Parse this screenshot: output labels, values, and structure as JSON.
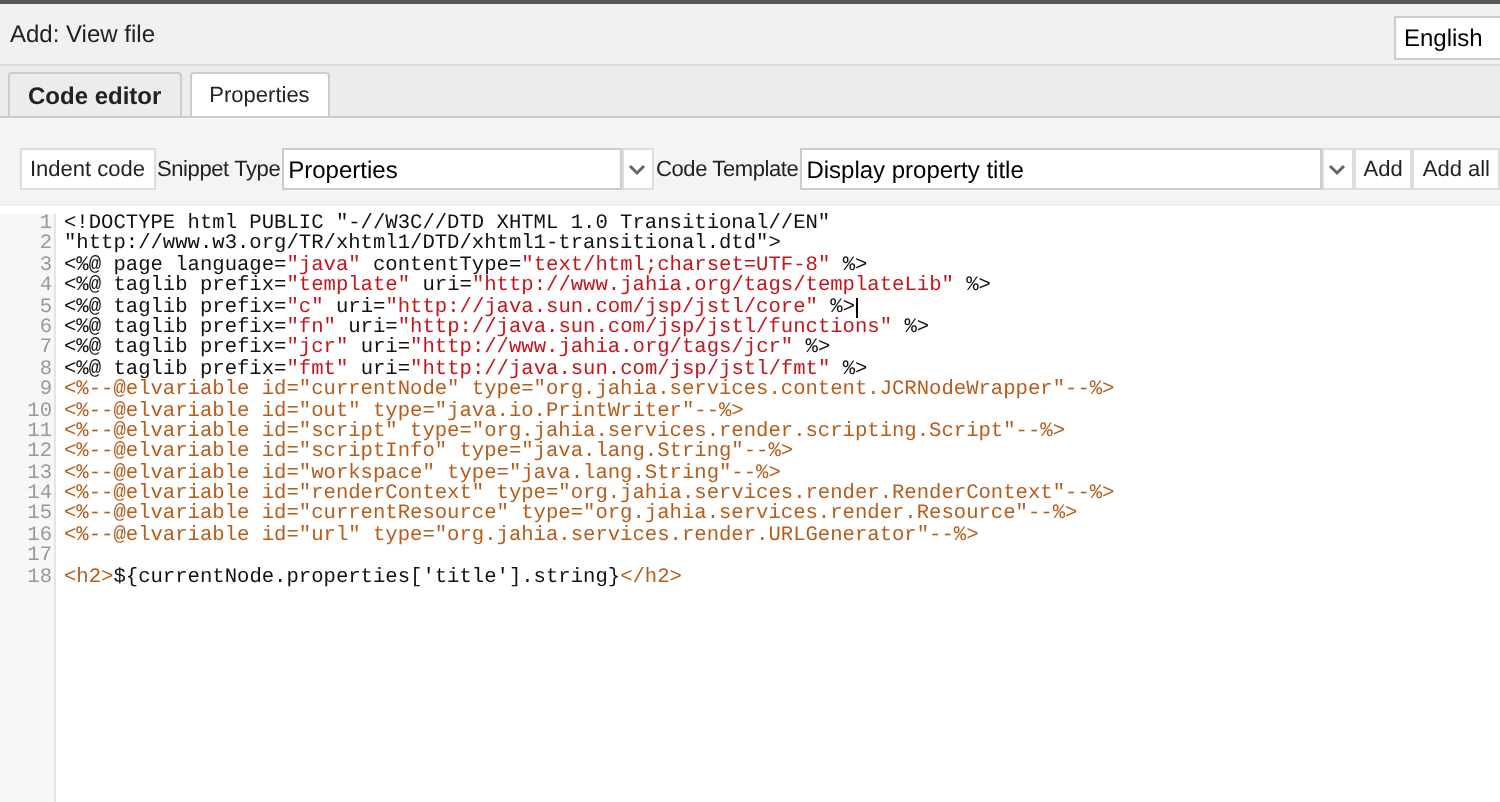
{
  "header": {
    "title": "Add: View file",
    "language": "English"
  },
  "tabs": [
    {
      "label": "Code editor",
      "selected": true
    },
    {
      "label": "Properties",
      "selected": false
    }
  ],
  "toolbar": {
    "indent_button": "Indent code",
    "snippet_label": "Snippet Type",
    "snippet_value": "Properties",
    "template_label": "Code Template",
    "template_value": "Display property title",
    "add_button": "Add",
    "add_all_button": "Add all"
  },
  "code_lines": [
    {
      "number": "1",
      "tokens": [
        {
          "kind": "plain",
          "text": "<!DOCTYPE html PUBLIC \"-//W3C//DTD XHTML 1.0 Transitional//EN\""
        }
      ]
    },
    {
      "number": "2",
      "tokens": [
        {
          "kind": "plain",
          "text": "\"http://www.w3.org/TR/xhtml1/DTD/xhtml1-transitional.dtd\">"
        }
      ]
    },
    {
      "number": "3",
      "tokens": [
        {
          "kind": "plain",
          "text": "<%@ page language="
        },
        {
          "kind": "string",
          "text": "\"java\""
        },
        {
          "kind": "plain",
          "text": " contentType="
        },
        {
          "kind": "string",
          "text": "\"text/html;charset=UTF-8\""
        },
        {
          "kind": "plain",
          "text": " %>"
        }
      ]
    },
    {
      "number": "4",
      "tokens": [
        {
          "kind": "plain",
          "text": "<%@ taglib prefix="
        },
        {
          "kind": "string",
          "text": "\"template\""
        },
        {
          "kind": "plain",
          "text": " uri="
        },
        {
          "kind": "string",
          "text": "\"http://www.jahia.org/tags/templateLib\""
        },
        {
          "kind": "plain",
          "text": " %>"
        }
      ]
    },
    {
      "number": "5",
      "cursor": true,
      "tokens": [
        {
          "kind": "plain",
          "text": "<%@ taglib prefix="
        },
        {
          "kind": "string",
          "text": "\"c\""
        },
        {
          "kind": "plain",
          "text": " uri="
        },
        {
          "kind": "string",
          "text": "\"http://java.sun.com/jsp/jstl/core\""
        },
        {
          "kind": "plain",
          "text": " %>"
        }
      ]
    },
    {
      "number": "6",
      "tokens": [
        {
          "kind": "plain",
          "text": "<%@ taglib prefix="
        },
        {
          "kind": "string",
          "text": "\"fn\""
        },
        {
          "kind": "plain",
          "text": " uri="
        },
        {
          "kind": "string",
          "text": "\"http://java.sun.com/jsp/jstl/functions\""
        },
        {
          "kind": "plain",
          "text": " %>"
        }
      ]
    },
    {
      "number": "7",
      "tokens": [
        {
          "kind": "plain",
          "text": "<%@ taglib prefix="
        },
        {
          "kind": "string",
          "text": "\"jcr\""
        },
        {
          "kind": "plain",
          "text": " uri="
        },
        {
          "kind": "string",
          "text": "\"http://www.jahia.org/tags/jcr\""
        },
        {
          "kind": "plain",
          "text": " %>"
        }
      ]
    },
    {
      "number": "8",
      "tokens": [
        {
          "kind": "plain",
          "text": "<%@ taglib prefix="
        },
        {
          "kind": "string",
          "text": "\"fmt\""
        },
        {
          "kind": "plain",
          "text": " uri="
        },
        {
          "kind": "string",
          "text": "\"http://java.sun.com/jsp/jstl/fmt\""
        },
        {
          "kind": "plain",
          "text": " %>"
        }
      ]
    },
    {
      "number": "9",
      "tokens": [
        {
          "kind": "comment",
          "text": "<%--@elvariable id=\"currentNode\" type=\"org.jahia.services.content.JCRNodeWrapper\"--%>"
        }
      ]
    },
    {
      "number": "10",
      "tokens": [
        {
          "kind": "comment",
          "text": "<%--@elvariable id=\"out\" type=\"java.io.PrintWriter\"--%>"
        }
      ]
    },
    {
      "number": "11",
      "tokens": [
        {
          "kind": "comment",
          "text": "<%--@elvariable id=\"script\" type=\"org.jahia.services.render.scripting.Script\"--%>"
        }
      ]
    },
    {
      "number": "12",
      "tokens": [
        {
          "kind": "comment",
          "text": "<%--@elvariable id=\"scriptInfo\" type=\"java.lang.String\"--%>"
        }
      ]
    },
    {
      "number": "13",
      "tokens": [
        {
          "kind": "comment",
          "text": "<%--@elvariable id=\"workspace\" type=\"java.lang.String\"--%>"
        }
      ]
    },
    {
      "number": "14",
      "tokens": [
        {
          "kind": "comment",
          "text": "<%--@elvariable id=\"renderContext\" type=\"org.jahia.services.render.RenderContext\"--%>"
        }
      ]
    },
    {
      "number": "15",
      "tokens": [
        {
          "kind": "comment",
          "text": "<%--@elvariable id=\"currentResource\" type=\"org.jahia.services.render.Resource\"--%>"
        }
      ]
    },
    {
      "number": "16",
      "tokens": [
        {
          "kind": "comment",
          "text": "<%--@elvariable id=\"url\" type=\"org.jahia.services.render.URLGenerator\"--%>"
        }
      ]
    },
    {
      "number": "17"
    },
    {
      "number": "18",
      "tokens": [
        {
          "kind": "tag",
          "text": "<h2>"
        },
        {
          "kind": "plain",
          "text": "${currentNode.properties['title'].string}"
        },
        {
          "kind": "tag",
          "text": "</h2>"
        }
      ]
    }
  ]
}
